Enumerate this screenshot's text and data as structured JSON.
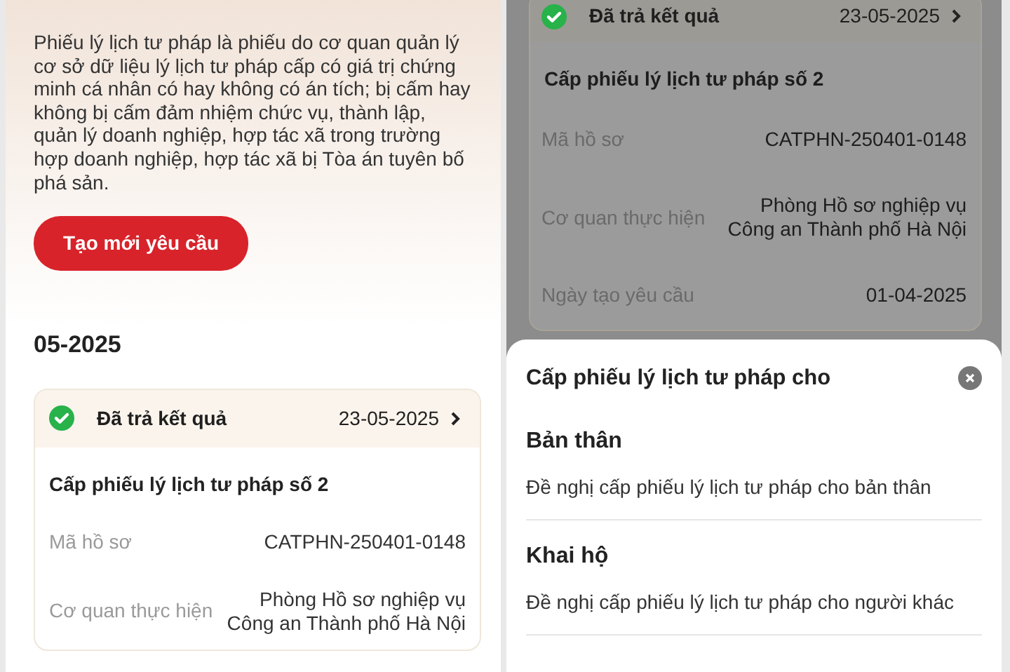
{
  "left_screen": {
    "description": "Phiếu lý lịch tư pháp là phiếu do cơ quan quản lý cơ sở dữ liệu lý lịch tư pháp cấp có giá trị chứng minh cá nhân có hay không có án tích; bị cấm hay không bị cấm đảm nhiệm chức vụ, thành lập, quản lý doanh nghiệp, hợp tác xã trong trường hợp doanh nghiệp, hợp tác xã bị Tòa án tuyên bố phá sản.",
    "create_button": "Tạo mới yêu cầu",
    "month": "05-2025",
    "request_card": {
      "status": "Đã trả kết quả",
      "date": "23-05-2025",
      "title": "Cấp phiếu lý lịch tư pháp số 2",
      "fields": [
        {
          "label": "Mã hồ sơ",
          "value": "CATPHN-250401-0148"
        },
        {
          "label": "Cơ quan thực hiện",
          "value": "Phòng Hồ sơ nghiệp vụ Công an Thành phố Hà Nội"
        }
      ]
    }
  },
  "right_screen": {
    "dimmed": true,
    "request_card": {
      "status": "Đã trả kết quả",
      "date": "23-05-2025",
      "title": "Cấp phiếu lý lịch tư pháp số 2",
      "fields": [
        {
          "label": "Mã hồ sơ",
          "value": "CATPHN-250401-0148"
        },
        {
          "label": "Cơ quan thực hiện",
          "value": "Phòng Hồ sơ nghiệp vụ Công an Thành phố Hà Nội"
        },
        {
          "label": "Ngày tạo yêu cầu",
          "value": "01-04-2025"
        }
      ]
    },
    "sheet": {
      "title": "Cấp phiếu lý lịch tư pháp cho",
      "options": [
        {
          "title": "Bản thân",
          "subtitle": "Đề nghị cấp phiếu lý lịch tư pháp cho bản thân"
        },
        {
          "title": "Khai hộ",
          "subtitle": "Đề nghị cấp phiếu lý lịch tư pháp cho người khác"
        }
      ]
    }
  }
}
